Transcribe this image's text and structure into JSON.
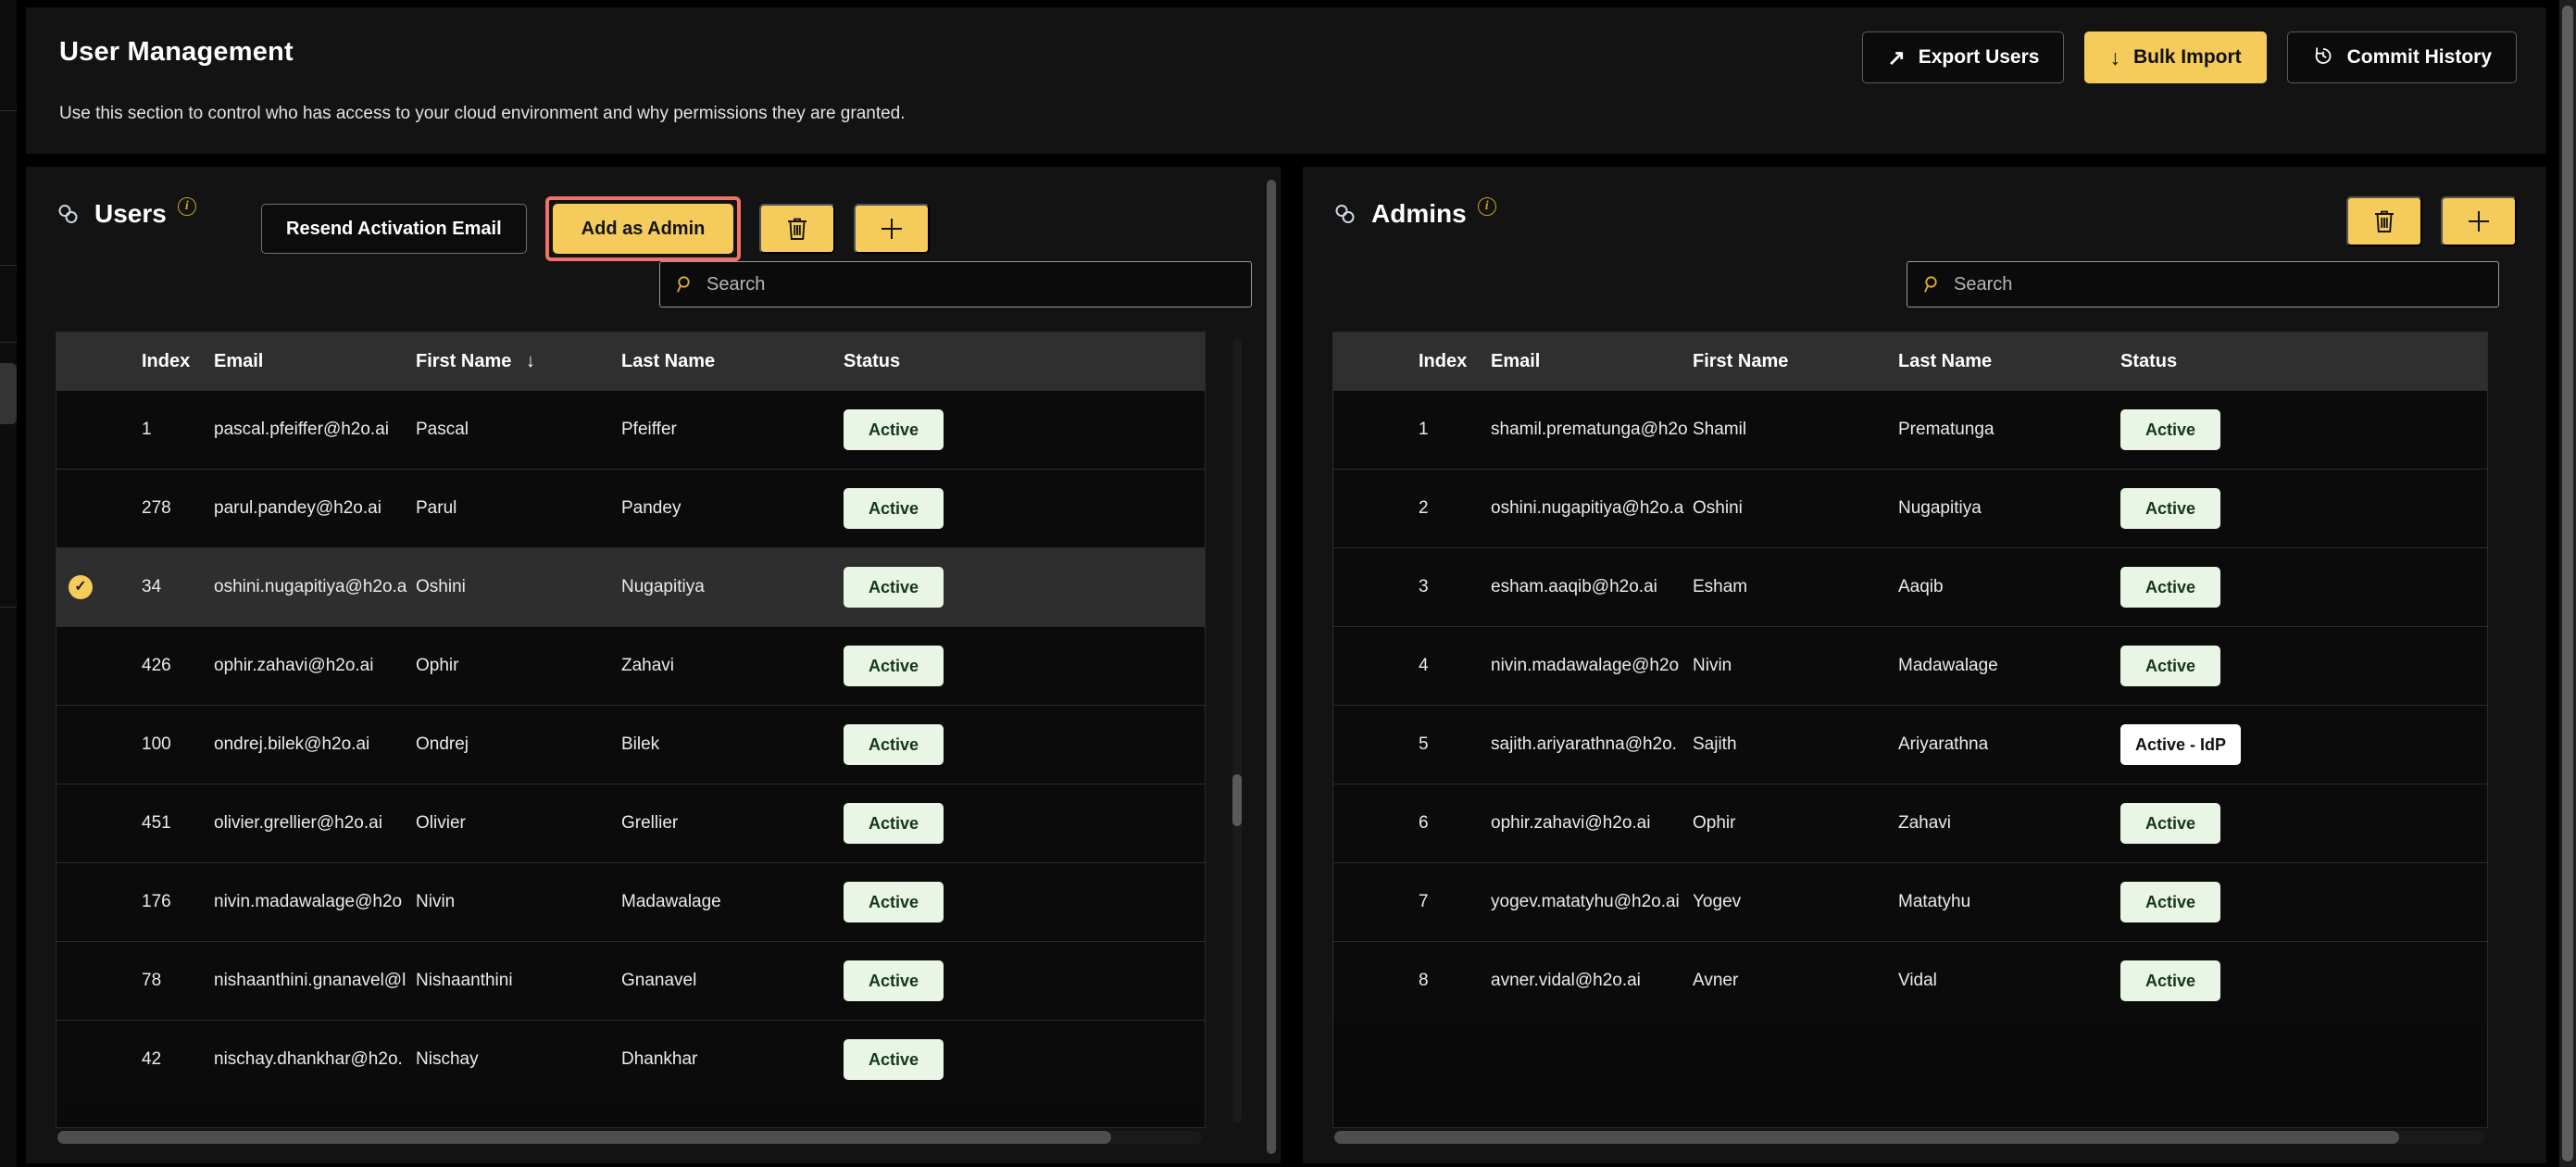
{
  "header": {
    "title": "User Management",
    "subtitle": "Use this section to control who has access to your cloud environment and why permissions they are granted.",
    "actions": [
      {
        "label": "Export Users",
        "icon": "external-link-icon",
        "glyph": "↗",
        "style": "outline"
      },
      {
        "label": "Bulk Import",
        "icon": "download-icon",
        "glyph": "↓",
        "style": "solid"
      },
      {
        "label": "Commit History",
        "icon": "history-icon",
        "glyph": "↺",
        "style": "outline"
      }
    ]
  },
  "colors": {
    "page_bg": "#000000",
    "card_bg": "#131313",
    "accent_yellow": "#F5CB5C",
    "highlight_red": "#F2726A",
    "badge_active_bg": "#E9F6E5",
    "badge_active_text": "#14371A",
    "badge_idp_bg": "#FFFFFF",
    "header_row_bg": "#2F2F2F",
    "selected_row_bg": "#2E2E2E"
  },
  "users_panel": {
    "title": "Users",
    "link_icon": "chain-link-icon",
    "info_icon": "info-icon",
    "buttons": {
      "resend": "Resend Activation Email",
      "add_as_admin": "Add as Admin",
      "delete_icon": "trash-icon",
      "add_icon": "plus-icon"
    },
    "add_as_admin_highlighted": true,
    "search": {
      "placeholder": "Search",
      "value": "",
      "icon": "search-icon"
    },
    "columns": [
      "Index",
      "Email",
      "First Name",
      "Last Name",
      "Status"
    ],
    "sorted_column": "First Name",
    "sort_direction": "descending",
    "sort_glyph": "↓",
    "rows": [
      {
        "selected": false,
        "index": "1",
        "email": "pascal.pfeiffer@h2o.ai",
        "first": "Pascal",
        "last": "Pfeiffer",
        "status": "Active"
      },
      {
        "selected": false,
        "index": "278",
        "email": "parul.pandey@h2o.ai",
        "first": "Parul",
        "last": "Pandey",
        "status": "Active"
      },
      {
        "selected": true,
        "index": "34",
        "email": "oshini.nugapitiya@h2o.a",
        "first": "Oshini",
        "last": "Nugapitiya",
        "status": "Active"
      },
      {
        "selected": false,
        "index": "426",
        "email": "ophir.zahavi@h2o.ai",
        "first": "Ophir",
        "last": "Zahavi",
        "status": "Active"
      },
      {
        "selected": false,
        "index": "100",
        "email": "ondrej.bilek@h2o.ai",
        "first": "Ondrej",
        "last": "Bilek",
        "status": "Active"
      },
      {
        "selected": false,
        "index": "451",
        "email": "olivier.grellier@h2o.ai",
        "first": "Olivier",
        "last": "Grellier",
        "status": "Active"
      },
      {
        "selected": false,
        "index": "176",
        "email": "nivin.madawalage@h2o",
        "first": "Nivin",
        "last": "Madawalage",
        "status": "Active"
      },
      {
        "selected": false,
        "index": "78",
        "email": "nishaanthini.gnanavel@l",
        "first": "Nishaanthini",
        "last": "Gnanavel",
        "status": "Active"
      },
      {
        "selected": false,
        "index": "42",
        "email": "nischay.dhankhar@h2o.",
        "first": "Nischay",
        "last": "Dhankhar",
        "status": "Active"
      }
    ]
  },
  "admins_panel": {
    "title": "Admins",
    "link_icon": "chain-link-icon",
    "info_icon": "info-icon",
    "buttons": {
      "delete_icon": "trash-icon",
      "add_icon": "plus-icon"
    },
    "search": {
      "placeholder": "Search",
      "value": "",
      "icon": "search-icon"
    },
    "columns": [
      "Index",
      "Email",
      "First Name",
      "Last Name",
      "Status"
    ],
    "rows": [
      {
        "index": "1",
        "email": "shamil.prematunga@h2o",
        "first": "Shamil",
        "last": "Prematunga",
        "status": "Active"
      },
      {
        "index": "2",
        "email": "oshini.nugapitiya@h2o.a",
        "first": "Oshini",
        "last": "Nugapitiya",
        "status": "Active"
      },
      {
        "index": "3",
        "email": "esham.aaqib@h2o.ai",
        "first": "Esham",
        "last": "Aaqib",
        "status": "Active"
      },
      {
        "index": "4",
        "email": "nivin.madawalage@h2o",
        "first": "Nivin",
        "last": "Madawalage",
        "status": "Active"
      },
      {
        "index": "5",
        "email": "sajith.ariyarathna@h2o.",
        "first": "Sajith",
        "last": "Ariyarathna",
        "status": "Active - IdP"
      },
      {
        "index": "6",
        "email": "ophir.zahavi@h2o.ai",
        "first": "Ophir",
        "last": "Zahavi",
        "status": "Active"
      },
      {
        "index": "7",
        "email": "yogev.matatyhu@h2o.ai",
        "first": "Yogev",
        "last": "Matatyhu",
        "status": "Active"
      },
      {
        "index": "8",
        "email": "avner.vidal@h2o.ai",
        "first": "Avner",
        "last": "Vidal",
        "status": "Active"
      }
    ]
  }
}
